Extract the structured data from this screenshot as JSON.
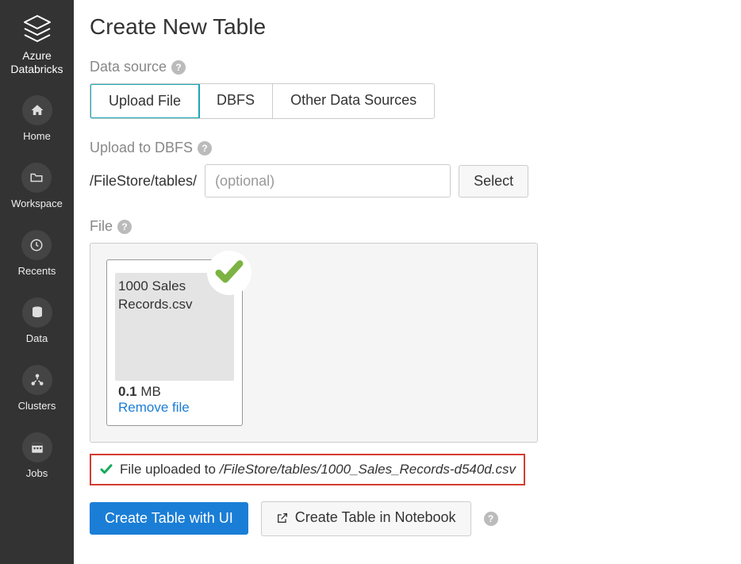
{
  "sidebar": {
    "brand": "Azure Databricks",
    "items": [
      {
        "label": "Home"
      },
      {
        "label": "Workspace"
      },
      {
        "label": "Recents"
      },
      {
        "label": "Data"
      },
      {
        "label": "Clusters"
      },
      {
        "label": "Jobs"
      }
    ]
  },
  "page": {
    "title": "Create New Table",
    "data_source_label": "Data source",
    "tabs": [
      {
        "label": "Upload File"
      },
      {
        "label": "DBFS"
      },
      {
        "label": "Other Data Sources"
      }
    ],
    "upload_section_label": "Upload to DBFS",
    "upload_path_prefix": "/FileStore/tables/",
    "upload_placeholder": "(optional)",
    "select_button": "Select",
    "file_section_label": "File",
    "file": {
      "name": "1000 Sales Records.csv",
      "size_value": "0.1",
      "size_unit": "MB",
      "remove_label": "Remove file"
    },
    "status_prefix": "File uploaded to",
    "status_path": "/FileStore/tables/1000_Sales_Records-d540d.csv",
    "create_ui_button": "Create Table with UI",
    "create_nb_button": "Create Table in Notebook"
  }
}
